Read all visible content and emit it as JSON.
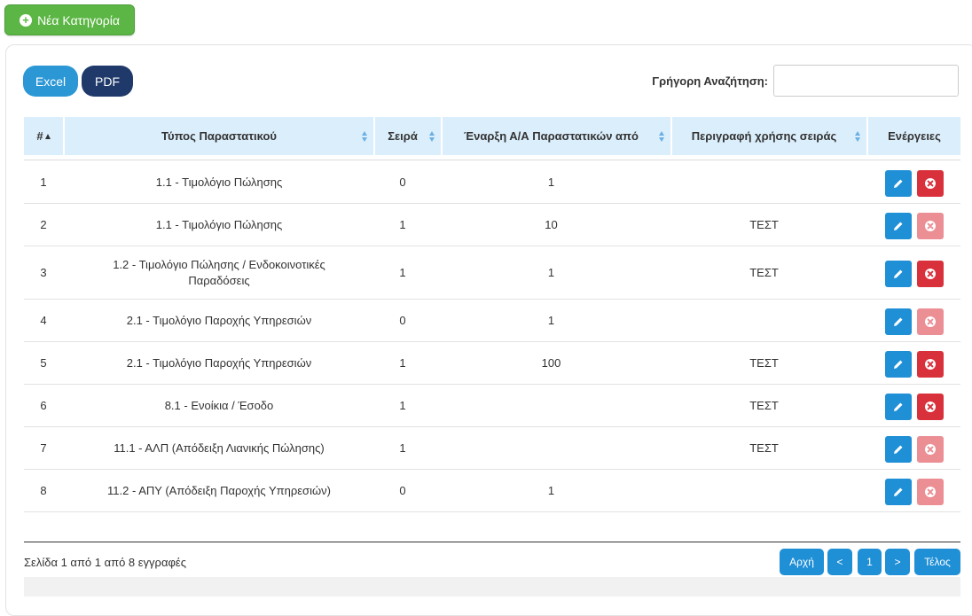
{
  "toolbar": {
    "new_category_label": "Νέα Κατηγορία",
    "excel_label": "Excel",
    "pdf_label": "PDF"
  },
  "search": {
    "label": "Γρήγορη Αναζήτηση:",
    "value": ""
  },
  "table": {
    "headers": {
      "num": "#",
      "type": "Τύπος Παραστατικού",
      "series": "Σειρά",
      "start": "Έναρξη Α/Α Παραστατικών από",
      "desc": "Περιγραφή χρήσης σειράς",
      "actions": "Ενέργειες"
    },
    "rows": [
      {
        "num": "1",
        "type": "1.1 - Τιμολόγιο Πώλησης",
        "series": "0",
        "start": "1",
        "desc": "",
        "delete_enabled": true
      },
      {
        "num": "2",
        "type": "1.1 - Τιμολόγιο Πώλησης",
        "series": "1",
        "start": "10",
        "desc": "ΤΕΣΤ",
        "delete_enabled": false
      },
      {
        "num": "3",
        "type": "1.2 - Τιμολόγιο Πώλησης / Ενδοκοινοτικές Παραδόσεις",
        "series": "1",
        "start": "1",
        "desc": "ΤΕΣΤ",
        "delete_enabled": true
      },
      {
        "num": "4",
        "type": "2.1 - Τιμολόγιο Παροχής Υπηρεσιών",
        "series": "0",
        "start": "1",
        "desc": "",
        "delete_enabled": false
      },
      {
        "num": "5",
        "type": "2.1 - Τιμολόγιο Παροχής Υπηρεσιών",
        "series": "1",
        "start": "100",
        "desc": "ΤΕΣΤ",
        "delete_enabled": true
      },
      {
        "num": "6",
        "type": "8.1 - Ενοίκια / Έσοδο",
        "series": "1",
        "start": "",
        "desc": "ΤΕΣΤ",
        "delete_enabled": true
      },
      {
        "num": "7",
        "type": "11.1 - ΑΛΠ (Απόδειξη Λιανικής Πώλησης)",
        "series": "1",
        "start": "",
        "desc": "ΤΕΣΤ",
        "delete_enabled": false
      },
      {
        "num": "8",
        "type": "11.2 - ΑΠΥ (Απόδειξη Παροχής Υπηρεσιών)",
        "series": "0",
        "start": "1",
        "desc": "",
        "delete_enabled": false
      }
    ]
  },
  "pagination": {
    "info": "Σελίδα 1 από 1 από 8 εγγραφές",
    "first_label": "Αρχή",
    "prev_label": "<",
    "current_page": "1",
    "next_label": ">",
    "last_label": "Τέλος"
  },
  "icons": {
    "new_category": "plus-circle-icon",
    "edit": "pencil-icon",
    "delete": "times-circle-icon",
    "sort": "sort-arrows-icon"
  },
  "colors": {
    "new_button": "#5cb645",
    "excel": "#2b97d5",
    "pdf": "#1f3a6a",
    "header_bg": "#dbeefb",
    "edit": "#1f8fd6",
    "delete": "#d9313c",
    "delete_disabled": "#eb8f95"
  }
}
